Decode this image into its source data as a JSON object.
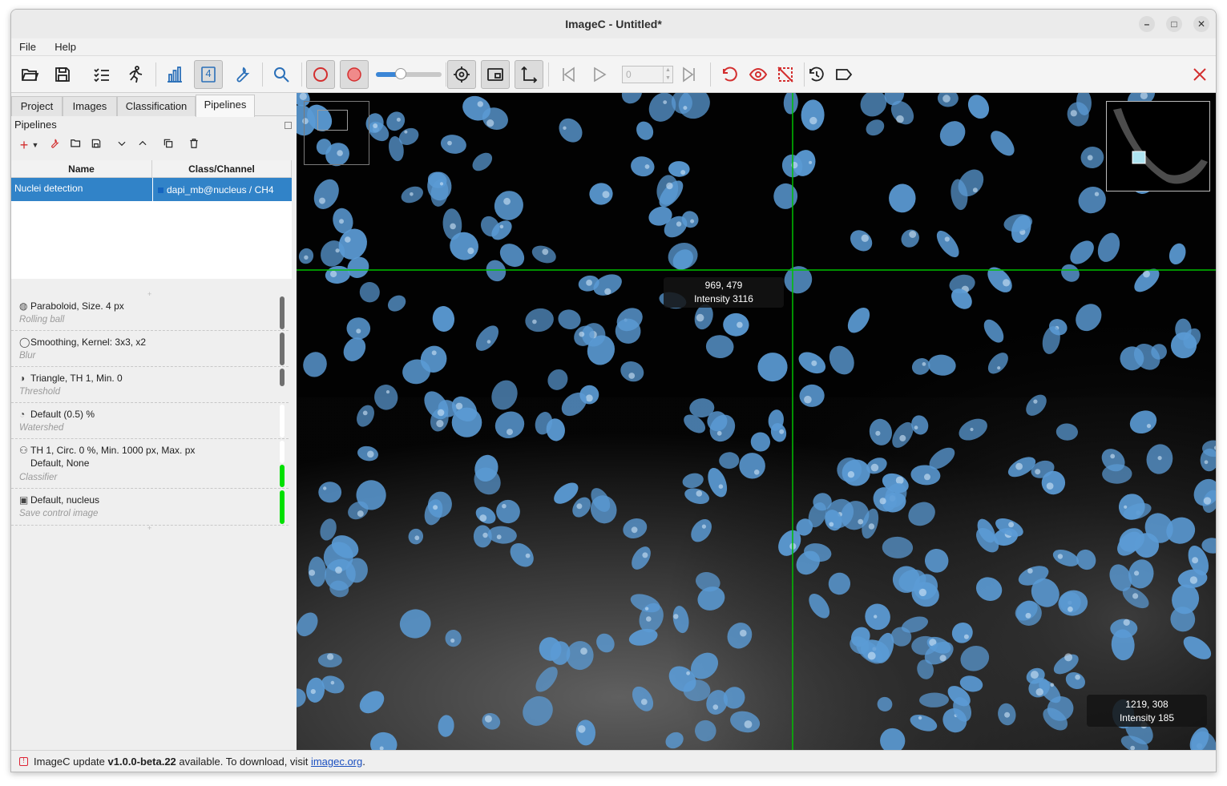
{
  "window": {
    "title": "ImageC - Untitled*"
  },
  "menu": [
    "File",
    "Help"
  ],
  "toolbar": {
    "frame_value": "0",
    "channel_badge": "4",
    "icons": [
      "open-folder-icon",
      "save-icon",
      "checklist-icon",
      "run-icon",
      "bar-chart-icon",
      "channel-icon",
      "wrench-icon",
      "search-icon",
      "circle-outline-icon",
      "circle-filled-icon",
      "target-icon",
      "picture-in-picture-icon",
      "axis-icon",
      "skip-back-icon",
      "play-icon",
      "skip-forward-icon",
      "undo-icon",
      "eye-icon",
      "selection-off-icon",
      "history-icon",
      "tag-icon",
      "close-icon"
    ],
    "accent": "#d32f2f"
  },
  "tabs": [
    "Project",
    "Images",
    "Classification",
    "Pipelines"
  ],
  "pipelines": {
    "title": "Pipelines",
    "columns": [
      "Name",
      "Class/Channel"
    ],
    "rows": [
      {
        "name": "Nuclei detection",
        "channel": "dapi_mb@nucleus / CH4",
        "color": "#1565c0"
      }
    ]
  },
  "steps": [
    {
      "title": "Paraboloid, Size. 4 px",
      "subtitle": "Rolling ball",
      "icon": "globe-icon",
      "status_color": "#6f6f6f"
    },
    {
      "title": "Smoothing, Kernel: 3x3, x2",
      "subtitle": "Blur",
      "icon": "drop-icon",
      "status_color": "#6f6f6f"
    },
    {
      "title": "Triangle, TH 1, Min. 0",
      "subtitle": "Threshold",
      "icon": "half-circle-icon",
      "status_color": "#6f6f6f"
    },
    {
      "title": "Default (0.5) %",
      "subtitle": "Watershed",
      "icon": "watershed-icon",
      "status_color": "#ffffff"
    },
    {
      "title": "TH 1, Circ. 0 %, Min. 1000 px, Max. px",
      "title2": "Default, None",
      "subtitle": "Classifier",
      "icon": "classifier-icon",
      "status_color": "#00e000"
    },
    {
      "title": "Default, nucleus",
      "subtitle": "Save control image",
      "icon": "image-icon",
      "status_color": "#00e000"
    }
  ],
  "viewer": {
    "cursor_readout": {
      "coords": "969, 479",
      "intensity": "Intensity 3116"
    },
    "corner_readout": {
      "coords": "1219, 308",
      "intensity": "Intensity 185"
    },
    "crosshair_color": "#00c000",
    "nucleus_color": "#5b9bd5"
  },
  "status": {
    "prefix": "ImageC update ",
    "version": "v1.0.0-beta.22",
    "middle": " available. To download, visit ",
    "link": "imagec.org",
    "suffix": "."
  }
}
